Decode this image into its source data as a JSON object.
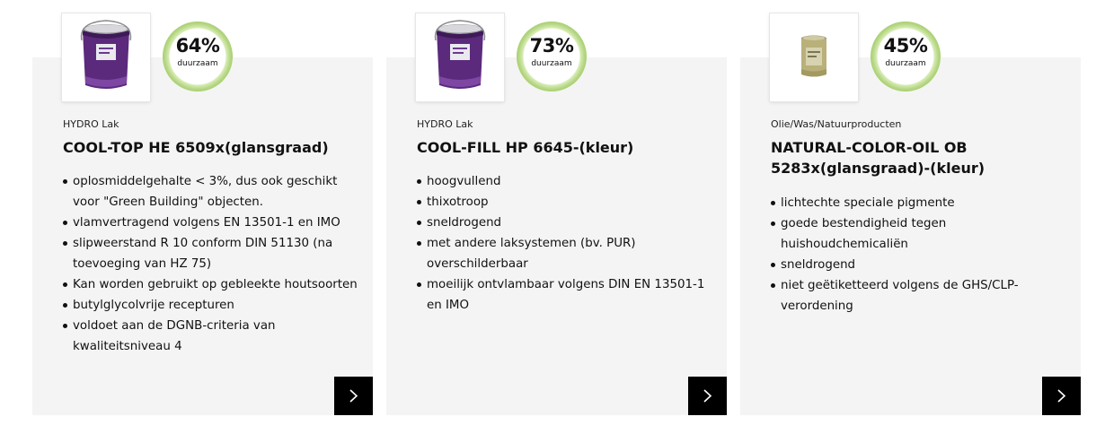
{
  "badge_label": "duurzaam",
  "colors": {
    "card_bg": "#f4f4f4",
    "badge_ring": "#a8cf6e",
    "button_bg": "#000000",
    "can_purple": "#5b2a7c",
    "can_gold": "#b9b07a"
  },
  "products": [
    {
      "score": "64%",
      "image": "purple-paint-bucket",
      "category": "HYDRO Lak",
      "title": "COOL-TOP HE 6509x(glansgraad)",
      "features": [
        "oplosmiddelgehalte < 3%, dus ook geschikt voor \"Green Building\" objecten.",
        "vlamvertragend volgens EN 13501-1 en IMO",
        "slipweerstand R 10 conform DIN 51130 (na toevoeging van HZ 75)",
        "Kan worden gebruikt op gebleekte houtsoorten",
        "butylglycolvrije recepturen",
        "voldoet aan de DGNB-criteria van kwaliteitsniveau 4"
      ]
    },
    {
      "score": "73%",
      "image": "purple-paint-bucket",
      "category": "HYDRO Lak",
      "title": "COOL-FILL HP 6645-(kleur)",
      "features": [
        "hoogvullend",
        "thixotroop",
        "sneldrogend",
        "met andere laksystemen (bv. PUR) overschilderbaar",
        "moeilijk ontvlambaar volgens DIN EN 13501-1 en IMO"
      ]
    },
    {
      "score": "45%",
      "image": "gold-oil-tin",
      "category": "Olie/Was/Natuurproducten",
      "title": "NATURAL-COLOR-OIL OB 5283x(glansgraad)-(kleur)",
      "features": [
        "lichtechte speciale pigmente",
        "goede bestendigheid tegen huishoudchemicaliën",
        "sneldrogend",
        "niet geëtiketteerd volgens de GHS/CLP-verordening"
      ]
    }
  ]
}
